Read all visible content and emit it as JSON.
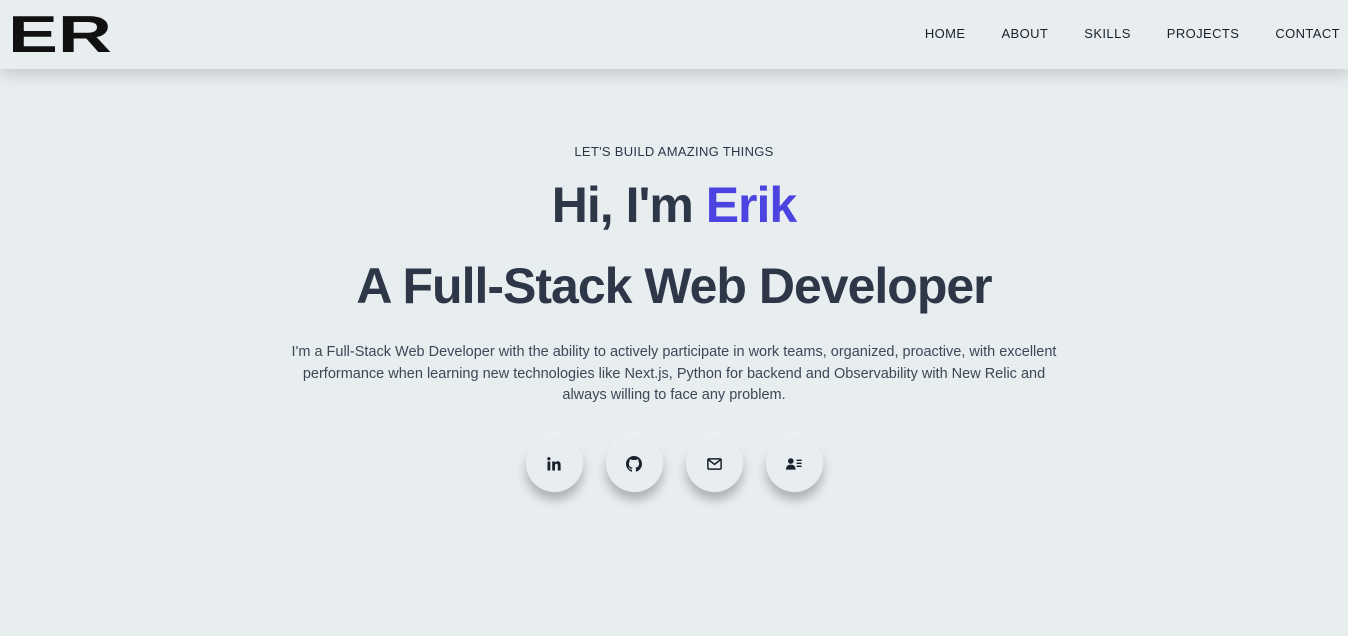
{
  "brand": {
    "logo_text": "ER"
  },
  "nav": {
    "items": [
      {
        "label": "HOME"
      },
      {
        "label": "ABOUT"
      },
      {
        "label": "SKILLS"
      },
      {
        "label": "PROJECTS"
      },
      {
        "label": "CONTACT"
      }
    ]
  },
  "hero": {
    "tagline": "LET'S BUILD AMAZING THINGS",
    "greeting": "Hi, I'm ",
    "name": "Erik",
    "role": "A Full-Stack Web Developer",
    "bio": "I'm a Full-Stack Web Developer with the ability to actively participate in work teams, organized, proactive, with excellent performance when learning new technologies like Next.js, Python for backend and Observability with New Relic and always willing to face any problem.",
    "name_color": "#4c44e0"
  },
  "socials": [
    {
      "icon": "linkedin-icon"
    },
    {
      "icon": "github-icon"
    },
    {
      "icon": "mail-icon"
    },
    {
      "icon": "contact-card-icon"
    }
  ]
}
